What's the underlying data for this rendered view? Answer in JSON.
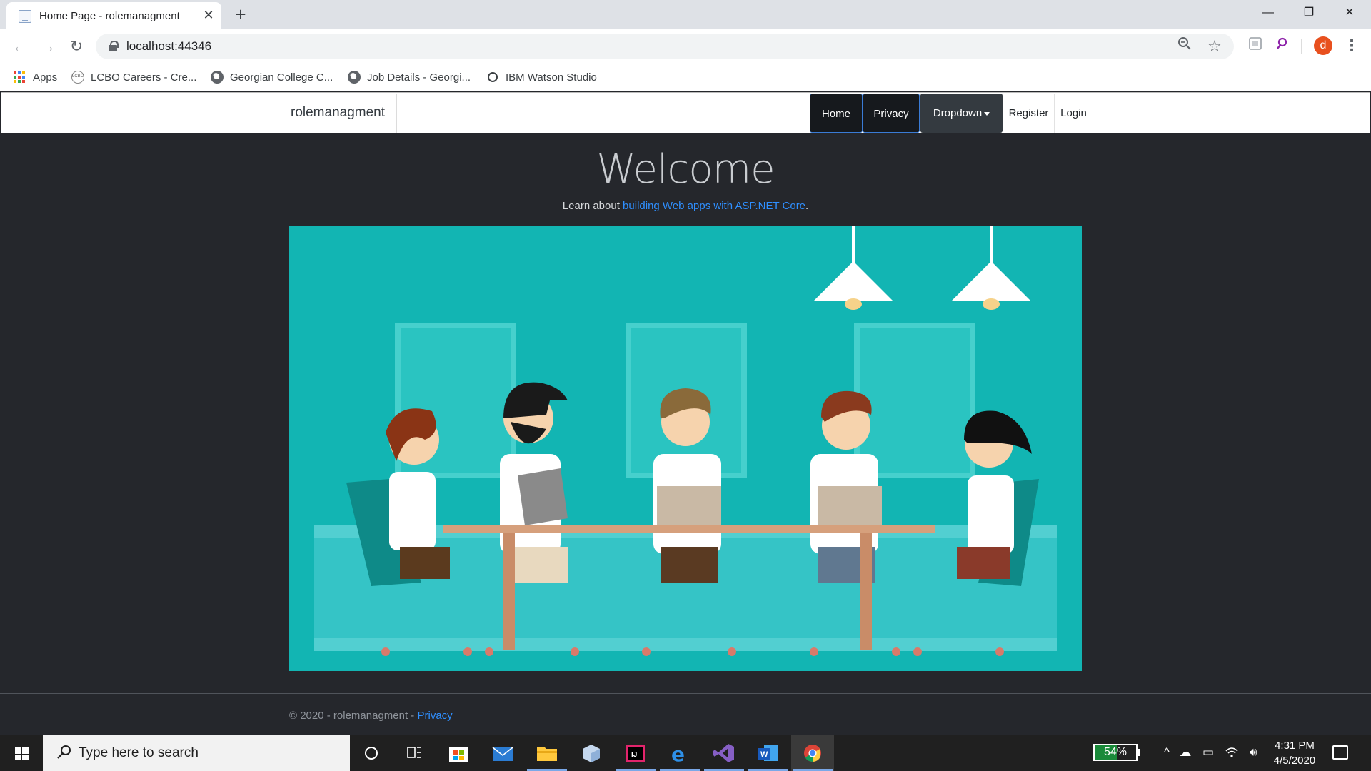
{
  "browser": {
    "tab_title": "Home Page - rolemanagment",
    "tab_close": "✕",
    "new_tab": "+",
    "url": "localhost:44346",
    "window_controls": {
      "minimize": "—",
      "restore": "❐",
      "close": "✕"
    },
    "nav": {
      "back": "←",
      "forward": "→",
      "reload": "↻"
    },
    "omnibox_icons": {
      "zoom": "zoom-icon",
      "bookmark": "☆"
    },
    "profile_initial": "d",
    "menu": "⋮"
  },
  "bookmarks": [
    {
      "label": "Apps",
      "icon": "apps-grid-icon"
    },
    {
      "label": "LCBO Careers - Cre...",
      "icon": "lcbo-icon"
    },
    {
      "label": "Georgian College C...",
      "icon": "globe-icon"
    },
    {
      "label": "Job Details - Georgi...",
      "icon": "globe-icon"
    },
    {
      "label": "IBM Watson Studio",
      "icon": "watson-icon"
    }
  ],
  "site": {
    "brand": "rolemanagment",
    "nav": {
      "home": "Home",
      "privacy": "Privacy",
      "dropdown": "Dropdown",
      "register": "Register",
      "login": "Login"
    },
    "welcome": "Welcome",
    "learn_prefix": "Learn about ",
    "learn_link": "building Web apps with ASP.NET Core",
    "learn_suffix": ".",
    "footer_text": "© 2020 - rolemanagment - ",
    "footer_link": "Privacy"
  },
  "taskbar": {
    "search_placeholder": "Type here to search",
    "battery": "54%",
    "battery_level": 0.54,
    "time": "4:31 PM",
    "date": "4/5/2020",
    "apps": [
      "cortana-icon",
      "task-view-icon",
      "store-icon",
      "mail-icon",
      "file-explorer-icon",
      "box-icon",
      "intellij-icon",
      "edge-icon",
      "visual-studio-icon",
      "word-icon",
      "chrome-icon"
    ]
  },
  "colors": {
    "page_bg": "#25272c",
    "hero_bg": "#12b5b3",
    "link": "#2f8fff",
    "nav_dark": "#16191d"
  }
}
